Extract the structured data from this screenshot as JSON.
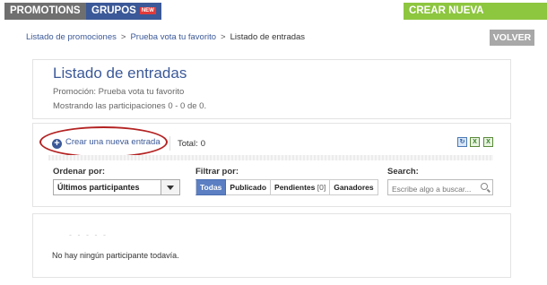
{
  "topbar": {
    "promotions_label": "PROMOTIONS",
    "grupos_label": "GRUPOS",
    "grupos_badge": "NEW",
    "create_promo_label": "CREAR NUEVA PROMOCIÓN"
  },
  "breadcrumb": {
    "items": [
      "Listado de promociones",
      "Prueba vota tu favorito",
      "Listado de entradas"
    ],
    "separator": ">"
  },
  "back_label": "VOLVER",
  "header": {
    "title": "Listado de entradas",
    "promotion_line": "Promoción: Prueba vota tu favorito",
    "count_line": "Mostrando las participaciones 0 - 0 de 0."
  },
  "toolbar": {
    "new_entry_label": "Crear una nueva entrada",
    "total_label": "Total:",
    "total_value": "0",
    "icons": [
      "refresh-icon",
      "excel-export-icon",
      "excel-export-all-icon"
    ]
  },
  "order": {
    "label": "Ordenar por:",
    "selected": "Últimos participantes"
  },
  "filter": {
    "label": "Filtrar por:",
    "options": [
      {
        "label": "Todas",
        "active": true
      },
      {
        "label": "Publicado",
        "active": false
      },
      {
        "label": "Pendientes",
        "count": "[0]",
        "active": false
      },
      {
        "label": "Ganadores",
        "active": false
      }
    ]
  },
  "search": {
    "label": "Search:",
    "placeholder": "Escribe algo a buscar..."
  },
  "results": {
    "faint_text": "- -   -   -   -",
    "empty_message": "No hay ningún participante todavía."
  },
  "colors": {
    "brand_blue": "#3b5998",
    "green": "#8dc63f",
    "gray": "#6f6f6f",
    "highlight_red": "#b42222",
    "active_filter": "#5b7fc2"
  }
}
